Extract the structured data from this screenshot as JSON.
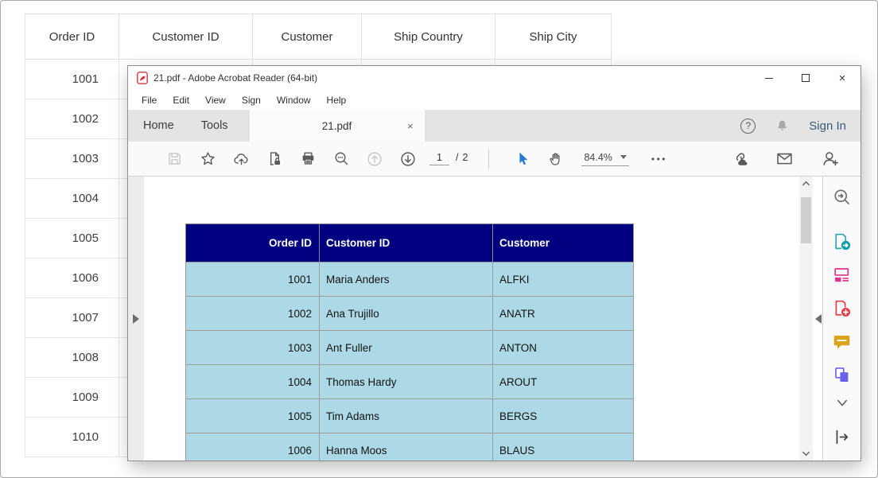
{
  "colors": {
    "pdf_header_bg": "#000080",
    "pdf_row_bg": "#ADD8E6",
    "cursor_tool": "#2779d8",
    "sign_in": "#3a5a78"
  },
  "background_table": {
    "headers": [
      "Order ID",
      "Customer ID",
      "Customer",
      "Ship Country",
      "Ship City"
    ],
    "rows": [
      "1001",
      "1002",
      "1003",
      "1004",
      "1005",
      "1006",
      "1007",
      "1008",
      "1009",
      "1010"
    ]
  },
  "acrobat": {
    "titlebar": {
      "title": "21.pdf - Adobe Acrobat Reader (64-bit)",
      "close_glyph": "×"
    },
    "menu": [
      "File",
      "Edit",
      "View",
      "Sign",
      "Window",
      "Help"
    ],
    "tabbar": {
      "home": "Home",
      "tools": "Tools",
      "document_tab": "21.pdf",
      "tab_close_glyph": "×",
      "help_glyph": "?",
      "sign_in": "Sign In"
    },
    "toolbar": {
      "page_current": "1",
      "page_separator": "/",
      "page_total": "2",
      "zoom_level": "84.4%",
      "more_glyph": "•••"
    },
    "pdf": {
      "table": {
        "headers": [
          "Order ID",
          "Customer ID",
          "Customer"
        ],
        "rows": [
          [
            "1001",
            "Maria Anders",
            "ALFKI"
          ],
          [
            "1002",
            "Ana Trujillo",
            "ANATR"
          ],
          [
            "1003",
            "Ant Fuller",
            "ANTON"
          ],
          [
            "1004",
            "Thomas Hardy",
            "AROUT"
          ],
          [
            "1005",
            "Tim Adams",
            "BERGS"
          ],
          [
            "1006",
            "Hanna Moos",
            "BLAUS"
          ]
        ]
      }
    }
  }
}
